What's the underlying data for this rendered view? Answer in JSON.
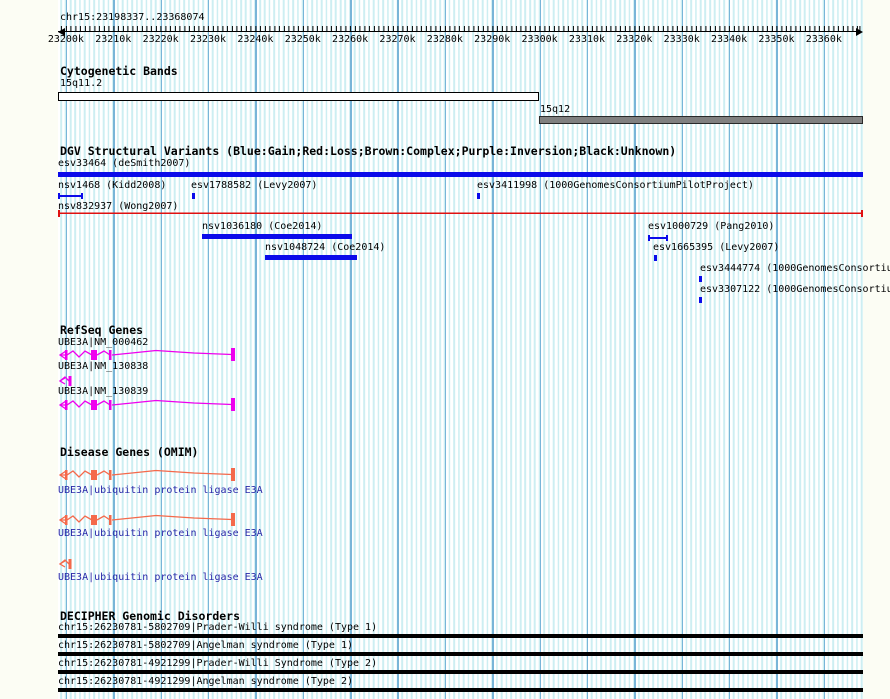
{
  "region": {
    "title": "chr15:23198337..23368074"
  },
  "ruler": {
    "tick_labels": [
      "23200k",
      "23210k",
      "23220k",
      "23230k",
      "23240k",
      "23250k",
      "23260k",
      "23270k",
      "23280k",
      "23290k",
      "23300k",
      "23310k",
      "23320k",
      "23330k",
      "23340k",
      "23350k",
      "23360k"
    ]
  },
  "tracks": {
    "cytobands": {
      "header": "Cytogenetic Bands",
      "bands": [
        {
          "name": "15q11.2"
        },
        {
          "name": "15q12"
        }
      ]
    },
    "dgv": {
      "header": "DGV Structural Variants (Blue:Gain;Red:Loss;Brown:Complex;Purple:Inversion;Black:Unknown)",
      "variants": [
        {
          "id": "esv33464",
          "label": "esv33464 (deSmith2007)",
          "type": "gain"
        },
        {
          "id": "nsv1468",
          "label": "nsv1468 (Kidd2008)",
          "type": "gain"
        },
        {
          "id": "esv1788582",
          "label": "esv1788582 (Levy2007)",
          "type": "gain"
        },
        {
          "id": "esv3411998",
          "label": "esv3411998 (1000GenomesConsortiumPilotProject)",
          "type": "gain"
        },
        {
          "id": "nsv832937",
          "label": "nsv832937 (Wong2007)",
          "type": "loss"
        },
        {
          "id": "nsv1036180",
          "label": "nsv1036180 (Coe2014)",
          "type": "gain"
        },
        {
          "id": "nsv1048724",
          "label": "nsv1048724 (Coe2014)",
          "type": "gain"
        },
        {
          "id": "esv1000729",
          "label": "esv1000729 (Pang2010)",
          "type": "gain"
        },
        {
          "id": "esv1665395",
          "label": "esv1665395 (Levy2007)",
          "type": "gain"
        },
        {
          "id": "esv3444774",
          "label": "esv3444774 (1000GenomesConsortiu",
          "type": "gain"
        },
        {
          "id": "esv3307122",
          "label": "esv3307122 (1000GenomesConsortiu",
          "type": "gain"
        }
      ]
    },
    "refseq": {
      "header": "RefSeq Genes",
      "genes": [
        {
          "label": "UBE3A|NM_000462"
        },
        {
          "label": "UBE3A|NM_130838"
        },
        {
          "label": "UBE3A|NM_130839"
        }
      ]
    },
    "omim": {
      "header": "Disease Genes (OMIM)",
      "genes": [
        {
          "label": "UBE3A|ubiquitin protein ligase E3A"
        },
        {
          "label": "UBE3A|ubiquitin protein ligase E3A"
        },
        {
          "label": "UBE3A|ubiquitin protein ligase E3A"
        }
      ]
    },
    "decipher": {
      "header": "DECIPHER Genomic Disorders",
      "rows": [
        {
          "label": "chr15:26230781-5802709|Prader-Willi syndrome (Type 1)"
        },
        {
          "label": "chr15:26230781-5802709|Angelman syndrome (Type 1)"
        },
        {
          "label": "chr15:26230781-4921299|Prader-Willi Syndrome (Type 2)"
        },
        {
          "label": "chr15:26230781-4921299|Angelman syndrome (Type 2)"
        }
      ]
    }
  },
  "colors": {
    "gain_blue": "#0b0bea",
    "loss_red": "#e01010",
    "refseq_gene": "#ee00ee",
    "omim_gene": "#f4694b",
    "omim_label_blue": "#2828a8",
    "grid_major": "#79b5d8",
    "grid_minor": "#cdeef2",
    "band_gray": "#808080"
  }
}
